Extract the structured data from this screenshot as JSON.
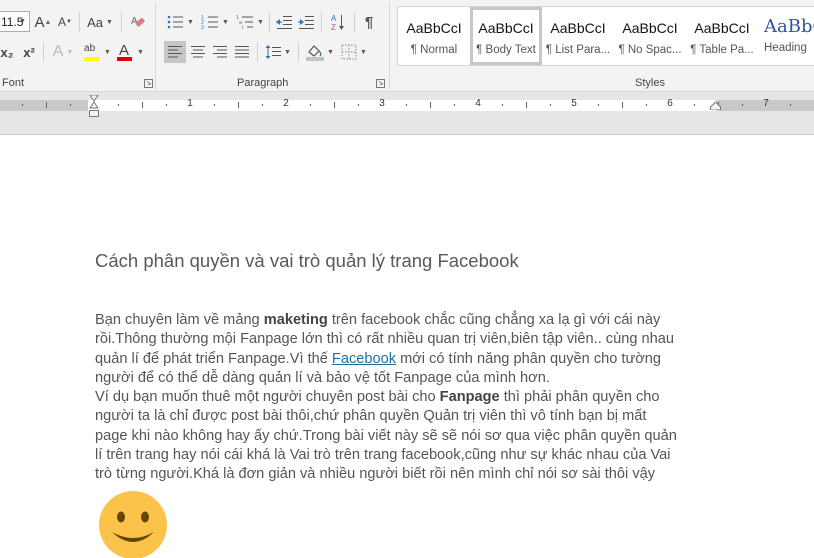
{
  "ribbon": {
    "font": {
      "group_label": "Font",
      "font_size_value": "11.5",
      "grow_font_icon": "A",
      "shrink_font_icon": "A",
      "change_case_label": "Aa",
      "subscript_label": "x₂",
      "superscript_label": "x²",
      "text_effects_label": "A",
      "highlight_label": "ab",
      "font_color_label": "A",
      "highlight_color": "#ffff00",
      "font_color": "#e00000"
    },
    "paragraph": {
      "group_label": "Paragraph",
      "alignment_selected": "left",
      "pilcrow_label": "¶",
      "sort_label": "A↓"
    },
    "styles": {
      "group_label": "Styles",
      "items": [
        {
          "preview": "AaBbCcI",
          "name": "¶ Normal",
          "selected": false
        },
        {
          "preview": "AaBbCcI",
          "name": "¶ Body Text",
          "selected": true
        },
        {
          "preview": "AaBbCcI",
          "name": "¶ List Para...",
          "selected": false
        },
        {
          "preview": "AaBbCcI",
          "name": "¶ No Spac...",
          "selected": false
        },
        {
          "preview": "AaBbCcI",
          "name": "¶ Table Pa...",
          "selected": false
        },
        {
          "preview": "AaBbC",
          "name": "Heading",
          "selected": false
        }
      ]
    }
  },
  "ruler": {
    "numbers": [
      "1",
      "2",
      "3",
      "4",
      "5",
      "6",
      "7"
    ]
  },
  "document": {
    "title": "Cách phân quyền và vai trò quản lý trang Facebook",
    "lines": [
      {
        "pre": "Bạn chuyên làm về mảng ",
        "bold": "maketing",
        "post": " trên facebook chắc cũng chẳng xa lạ gì với cái này"
      },
      {
        "text": "rồi.Thông thường mội Fanpage lớn thì có rất nhiều quan trị viên,biên tập viên.. cùng nhau"
      },
      {
        "pre": "quản lí để phát triển Fanpage.Vì thế ",
        "link": "Facebook",
        "post": " mới có tính năng phân quyền cho tường"
      },
      {
        "text": "người để có thể dễ dàng quản lí và bảo vệ tốt Fanpage của mình hơn."
      },
      {
        "pre": "Ví dụ bạn muốn thuê một người chuyên post bài cho ",
        "bold": "Fanpage",
        "post": " thì phải phân quyền cho"
      },
      {
        "text": "người ta là chỉ được post bài thôi,chứ phân quyền Quản trị viên thì vô tính bạn bị mất"
      },
      {
        "text": "page khi nào không hay ấy chứ.Trong bài viết này sẽ sẽ nói sơ qua việc phân quyền quản"
      },
      {
        "text": "lí trên trang hay nói cái khá là Vai trò trên trang facebook,cũng như sự khác nhau của Vai"
      },
      {
        "text": "trò từng người.Khá là đơn giản và nhiều người biết rồi nên mình chỉ nói sơ sài thôi vậy"
      }
    ],
    "emoji": "smiley-face",
    "link_color": "#1f6fa8",
    "text_color": "#555555"
  }
}
